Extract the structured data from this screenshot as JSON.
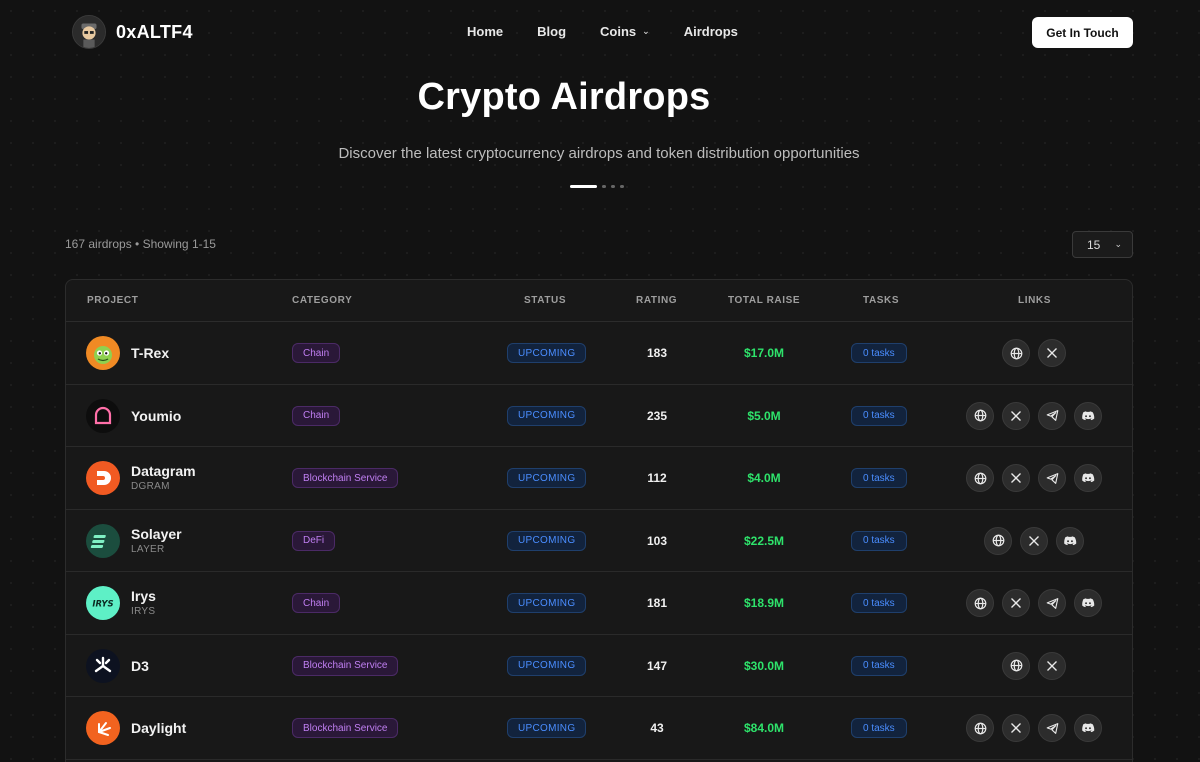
{
  "nav": {
    "brand": "0xALTF4",
    "menu": [
      {
        "label": "Home"
      },
      {
        "label": "Blog"
      },
      {
        "label": "Coins",
        "has_dropdown": true
      },
      {
        "label": "Airdrops"
      }
    ],
    "cta_label": "Get In Touch"
  },
  "hero": {
    "title": "Crypto Airdrops",
    "subtitle": "Discover the latest cryptocurrency airdrops and token distribution opportunities",
    "carousel_active_index": 0,
    "carousel_count": 4
  },
  "summary": {
    "count_text": "167 airdrops • Showing 1-15",
    "per_page": "15"
  },
  "table": {
    "headers": {
      "project": "PROJECT",
      "category": "CATEGORY",
      "status": "STATUS",
      "rating": "RATING",
      "total_raise": "TOTAL RAISE",
      "tasks": "TASKS",
      "links": "LINKS"
    },
    "rows": [
      {
        "name": "T-Rex",
        "ticker": "",
        "logo_color": "#f08a24",
        "logo_text": "",
        "category": "Chain",
        "status": "UPCOMING",
        "rating": "183",
        "raise": "$17.0M",
        "tasks": "0 tasks",
        "links": [
          "globe-icon",
          "x-icon"
        ]
      },
      {
        "name": "Youmio",
        "ticker": "",
        "logo_color": "#111111",
        "logo_text": "",
        "category": "Chain",
        "status": "UPCOMING",
        "rating": "235",
        "raise": "$5.0M",
        "tasks": "0 tasks",
        "links": [
          "globe-icon",
          "x-icon",
          "telegram-icon",
          "discord-icon"
        ]
      },
      {
        "name": "Datagram",
        "ticker": "DGRAM",
        "logo_color": "#f15a22",
        "logo_text": "",
        "category": "Blockchain Service",
        "status": "UPCOMING",
        "rating": "112",
        "raise": "$4.0M",
        "tasks": "0 tasks",
        "links": [
          "globe-icon",
          "x-icon",
          "telegram-icon",
          "discord-icon"
        ]
      },
      {
        "name": "Solayer",
        "ticker": "LAYER",
        "logo_color": "#1b4d3e",
        "logo_text": "",
        "category": "DeFi",
        "status": "UPCOMING",
        "rating": "103",
        "raise": "$22.5M",
        "tasks": "0 tasks",
        "links": [
          "globe-icon",
          "x-icon",
          "discord-icon"
        ]
      },
      {
        "name": "Irys",
        "ticker": "IRYS",
        "logo_color": "#5ef0c6",
        "logo_text": "IRYS",
        "category": "Chain",
        "status": "UPCOMING",
        "rating": "181",
        "raise": "$18.9M",
        "tasks": "0 tasks",
        "links": [
          "globe-icon",
          "x-icon",
          "telegram-icon",
          "discord-icon"
        ]
      },
      {
        "name": "D3",
        "ticker": "",
        "logo_color": "#0d1220",
        "logo_text": "",
        "category": "Blockchain Service",
        "status": "UPCOMING",
        "rating": "147",
        "raise": "$30.0M",
        "tasks": "0 tasks",
        "links": [
          "globe-icon",
          "x-icon"
        ]
      },
      {
        "name": "Daylight",
        "ticker": "",
        "logo_color": "#f2631f",
        "logo_text": "",
        "category": "Blockchain Service",
        "status": "UPCOMING",
        "rating": "43",
        "raise": "$84.0M",
        "tasks": "0 tasks",
        "links": [
          "globe-icon",
          "x-icon",
          "telegram-icon",
          "discord-icon"
        ]
      }
    ]
  },
  "watermark": "0xALTF4"
}
